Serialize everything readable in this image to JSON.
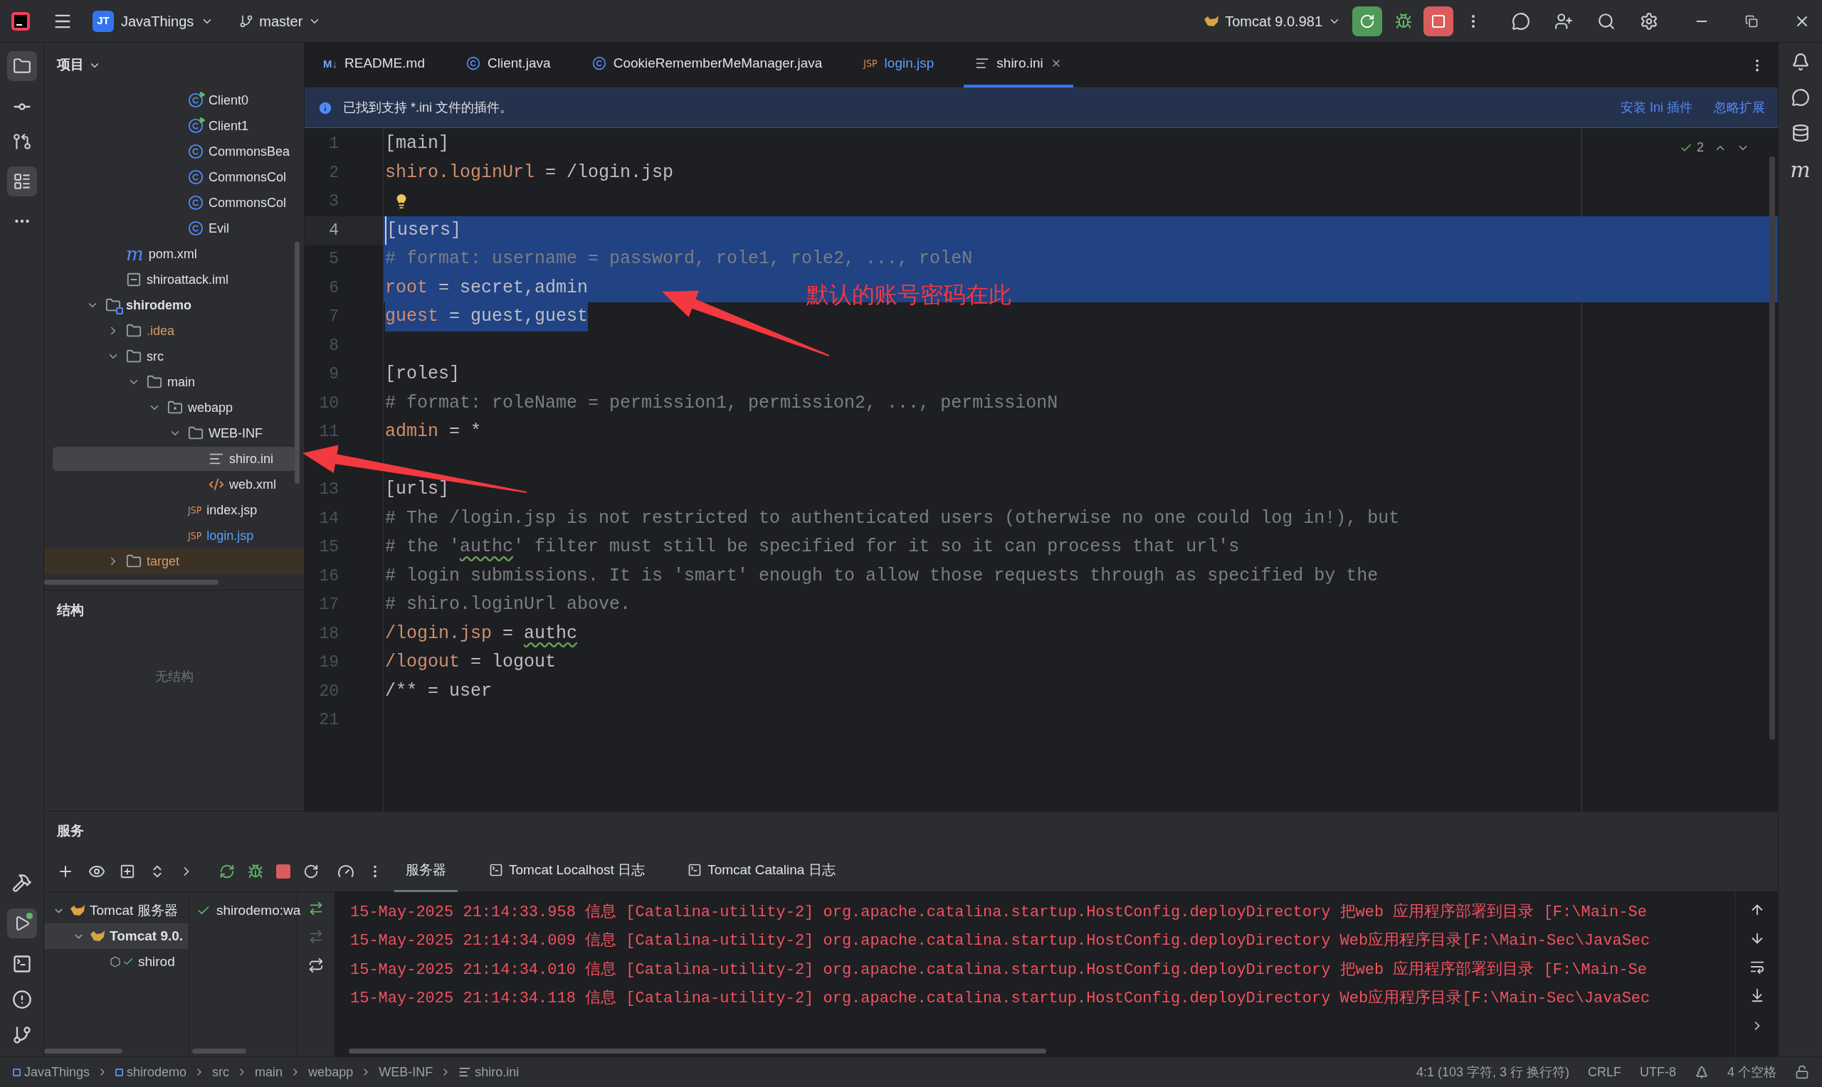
{
  "topbar": {
    "project_badge": "JT",
    "project": "JavaThings",
    "branch": "master",
    "run_config": "Tomcat 9.0.981"
  },
  "project_panel": {
    "title": "项目",
    "tree": [
      {
        "children": [
          {
            "children": [
              {
                "children": [
                  {
                    "children": [
                      {
                        "children": [
                          {
                            "label": "Client0",
                            "kind": "class-run"
                          },
                          {
                            "label": "Client1",
                            "kind": "class-run"
                          },
                          {
                            "label": "CommonsBea",
                            "kind": "class"
                          },
                          {
                            "label": "CommonsCol",
                            "kind": "class"
                          },
                          {
                            "label": "CommonsCol",
                            "kind": "class"
                          },
                          {
                            "label": "Evil",
                            "kind": "class"
                          }
                        ]
                      }
                    ]
                  }
                ]
              },
              {
                "label": "pom.xml",
                "kind": "maven",
                "icon_text": "m"
              },
              {
                "label": "shiroattack.iml",
                "kind": "iml"
              }
            ]
          },
          {
            "label": "shirodemo",
            "kind": "module",
            "expanded": true,
            "children": [
              {
                "label": ".idea",
                "kind": "folder",
                "expanded": false,
                "ignored": true
              },
              {
                "label": "src",
                "kind": "folder",
                "expanded": true,
                "children": [
                  {
                    "label": "main",
                    "kind": "folder",
                    "expanded": true,
                    "children": [
                      {
                        "label": "webapp",
                        "kind": "web",
                        "expanded": true,
                        "children": [
                          {
                            "label": "WEB-INF",
                            "kind": "folder",
                            "expanded": true,
                            "children": [
                              {
                                "label": "shiro.ini",
                                "kind": "ini",
                                "selected": true
                              },
                              {
                                "label": "web.xml",
                                "kind": "xml"
                              }
                            ]
                          },
                          {
                            "label": "index.jsp",
                            "kind": "jsp",
                            "icon_text": "JSP"
                          },
                          {
                            "label": "login.jsp",
                            "kind": "jsp",
                            "icon_text": "JSP",
                            "modified": true
                          }
                        ]
                      }
                    ]
                  }
                ]
              },
              {
                "label": "target",
                "kind": "folder",
                "expanded": false,
                "excluded": true
              }
            ]
          }
        ]
      }
    ]
  },
  "structure_panel": {
    "title": "结构",
    "empty_text": "无结构"
  },
  "tabs": [
    {
      "label": "README.md",
      "kind": "markdown",
      "icon_text": "M↓",
      "selected": false,
      "modified": false
    },
    {
      "label": "Client.java",
      "kind": "class",
      "selected": false,
      "modified": false
    },
    {
      "label": "CookieRememberMeManager.java",
      "kind": "class",
      "selected": false,
      "modified": false
    },
    {
      "label": "login.jsp",
      "kind": "jsp",
      "icon_text": "JSP",
      "selected": false,
      "modified": true
    },
    {
      "label": "shiro.ini",
      "kind": "ini",
      "selected": true,
      "modified": false
    }
  ],
  "banner": {
    "message": "已找到支持 *.ini 文件的插件。",
    "actions": [
      "安装 Ini 插件",
      "忽略扩展"
    ]
  },
  "editor": {
    "inspections": "2",
    "lines": [
      {
        "number": "1",
        "segments": [
          {
            "text": "[main]",
            "kind": "section"
          }
        ]
      },
      {
        "number": "2",
        "segments": [
          {
            "text": "shiro.loginUrl",
            "kind": "key"
          },
          {
            "text": " = /login.jsp",
            "kind": "value"
          }
        ]
      },
      {
        "number": "3",
        "bulb": true
      },
      {
        "number": "4",
        "current": true,
        "selected": true,
        "whole_line": true,
        "segments": [
          {
            "text": "[users]",
            "kind": "section"
          }
        ]
      },
      {
        "number": "5",
        "selected": true,
        "whole_line": true,
        "segments": [
          {
            "text": "# format: username = password, role1, role2, ..., roleN",
            "kind": "comment"
          }
        ]
      },
      {
        "number": "6",
        "selected": true,
        "whole_line": true,
        "segments": [
          {
            "text": "root",
            "kind": "key"
          },
          {
            "text": " = secret,admin",
            "kind": "value"
          }
        ]
      },
      {
        "number": "7",
        "selected": true,
        "segments": [
          {
            "text": "guest",
            "kind": "key"
          },
          {
            "text": " = guest,guest",
            "kind": "value"
          }
        ]
      },
      {
        "number": "8"
      },
      {
        "number": "9",
        "segments": [
          {
            "text": "[roles]",
            "kind": "section"
          }
        ]
      },
      {
        "number": "10",
        "segments": [
          {
            "text": "# format: roleName = permission1, permission2, ..., permissionN",
            "kind": "comment"
          }
        ]
      },
      {
        "number": "11",
        "segments": [
          {
            "text": "admin",
            "kind": "key"
          },
          {
            "text": " = *",
            "kind": "value"
          }
        ]
      },
      {
        "number": "13",
        "gap_before": true,
        "segments": [
          {
            "text": "[urls]",
            "kind": "section"
          }
        ]
      },
      {
        "number": "14",
        "segments": [
          {
            "text": "# The /login.jsp is not restricted to authenticated users (otherwise no one could log in!), but",
            "kind": "comment"
          }
        ]
      },
      {
        "number": "15",
        "segments": [
          {
            "text": "# the '",
            "kind": "comment"
          },
          {
            "text": "authc",
            "kind": "comment",
            "typo": true
          },
          {
            "text": "' filter must still be specified for it so it can process that url's",
            "kind": "comment"
          }
        ]
      },
      {
        "number": "16",
        "segments": [
          {
            "text": "# login submissions. It is 'smart' enough to allow those requests through as specified by the",
            "kind": "comment"
          }
        ]
      },
      {
        "number": "17",
        "segments": [
          {
            "text": "# shiro.loginUrl above.",
            "kind": "comment"
          }
        ]
      },
      {
        "number": "18",
        "segments": [
          {
            "text": "/login.jsp",
            "kind": "key"
          },
          {
            "text": " = ",
            "kind": "value"
          },
          {
            "text": "authc",
            "kind": "value",
            "typo": true
          }
        ]
      },
      {
        "number": "19",
        "segments": [
          {
            "text": "/logout",
            "kind": "key"
          },
          {
            "text": " = logout",
            "kind": "value"
          }
        ]
      },
      {
        "number": "20",
        "segments": [
          {
            "text": "/** = user",
            "kind": "value"
          }
        ]
      },
      {
        "number": "21"
      }
    ]
  },
  "annotation": {
    "text": "默认的账号密码在此"
  },
  "right_strip": {
    "maven_text": "m"
  },
  "services": {
    "title": "服务",
    "tree": [
      {
        "label": "Tomcat 服务器",
        "expanded": true,
        "selected": false,
        "children": [
          {
            "label": "Tomcat 9.0.",
            "expanded": true,
            "selected": true,
            "children": [
              {
                "label": "shirod",
                "selected": false
              }
            ]
          }
        ]
      }
    ],
    "deployment": "shirodemo:wa",
    "console_tabs": [
      {
        "label": "服务器",
        "selected": true
      },
      {
        "label": "Tomcat Localhost 日志",
        "selected": false
      },
      {
        "label": "Tomcat Catalina 日志",
        "selected": false
      }
    ],
    "log": [
      "15-May-2025 21:14:33.958 信息 [Catalina-utility-2] org.apache.catalina.startup.HostConfig.deployDirectory 把web 应用程序部署到目录 [F:\\Main-Se",
      "15-May-2025 21:14:34.009 信息 [Catalina-utility-2] org.apache.catalina.startup.HostConfig.deployDirectory Web应用程序目录[F:\\Main-Sec\\JavaSec",
      "15-May-2025 21:14:34.010 信息 [Catalina-utility-2] org.apache.catalina.startup.HostConfig.deployDirectory 把web 应用程序部署到目录 [F:\\Main-Se",
      "15-May-2025 21:14:34.118 信息 [Catalina-utility-2] org.apache.catalina.startup.HostConfig.deployDirectory Web应用程序目录[F:\\Main-Sec\\JavaSec"
    ]
  },
  "status_bar": {
    "breadcrumbs": [
      {
        "label": "JavaThings",
        "kind": "module"
      },
      {
        "label": "shirodemo",
        "kind": "module"
      },
      {
        "label": "src",
        "kind": "plain"
      },
      {
        "label": "main",
        "kind": "plain"
      },
      {
        "label": "webapp",
        "kind": "plain"
      },
      {
        "label": "WEB-INF",
        "kind": "plain"
      },
      {
        "label": "shiro.ini",
        "kind": "ini"
      }
    ],
    "position": "4:1 (103 字符, 3 行 换行符)",
    "line_separator": "CRLF",
    "encoding": "UTF-8",
    "indent": "4 个空格"
  }
}
